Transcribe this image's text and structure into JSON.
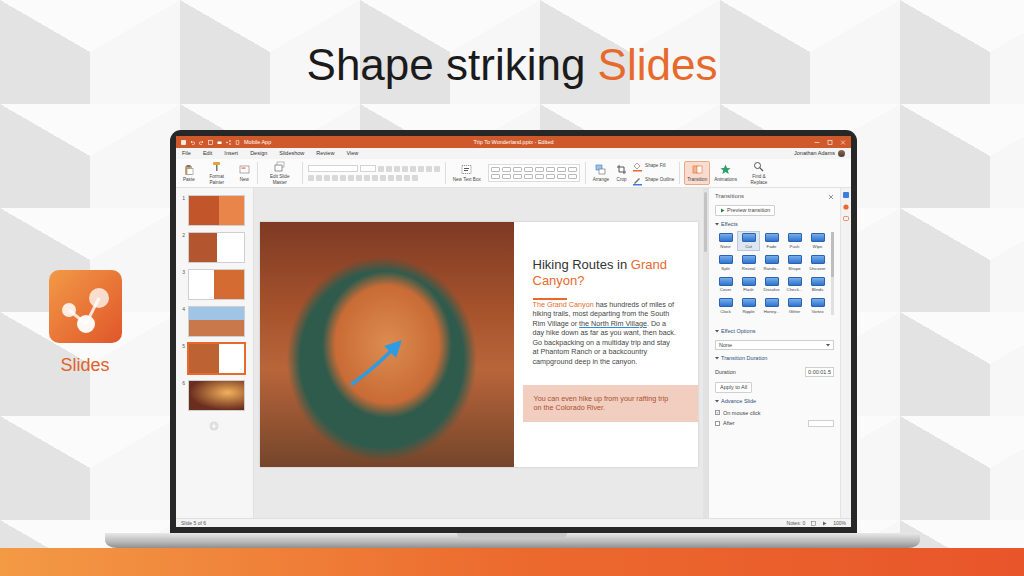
{
  "headline": [
    {
      "text": "Shape striking ",
      "kind": "plain"
    },
    {
      "text": "Slides",
      "kind": "accent"
    }
  ],
  "app_badge": {
    "label": "Slides"
  },
  "window": {
    "title": "Trip To Wonderland.pptx - Edited",
    "app_label": "Mobile App",
    "user": "Jonathan Adams"
  },
  "menu": [
    "File",
    "Edit",
    "Insert",
    "Design",
    "Slideshow",
    "Review",
    "View"
  ],
  "ribbon": [
    {
      "items": [
        {
          "label": "Paste",
          "kind": "large",
          "selected": false
        },
        {
          "label": "Format Painter",
          "kind": "large",
          "selected": false
        },
        {
          "label": "New",
          "kind": "large",
          "selected": false
        }
      ]
    },
    {
      "items": [
        {
          "label": "Edit Slide Master",
          "kind": "large",
          "selected": false
        }
      ]
    },
    {
      "items": [
        {
          "label": "New Text Box",
          "kind": "large",
          "selected": false
        }
      ]
    },
    {
      "items": [
        {
          "label": "Arrange",
          "kind": "large",
          "selected": false
        },
        {
          "label": "Crop",
          "kind": "large",
          "selected": false
        },
        {
          "label": "Shape Fill",
          "kind": "small",
          "selected": false
        },
        {
          "label": "Shape Outline",
          "kind": "small",
          "selected": false
        }
      ]
    },
    {
      "items": [
        {
          "label": "Transition",
          "kind": "large",
          "selected": true
        },
        {
          "label": "Animations",
          "kind": "large",
          "selected": false
        },
        {
          "label": "Find & Replace",
          "kind": "large",
          "selected": false
        }
      ]
    }
  ],
  "thumbnails": [
    {
      "number": "1",
      "selected": false
    },
    {
      "number": "2",
      "selected": false
    },
    {
      "number": "3",
      "selected": false
    },
    {
      "number": "4",
      "selected": false
    },
    {
      "number": "5",
      "selected": true
    },
    {
      "number": "6",
      "selected": false
    }
  ],
  "slide": {
    "title": [
      {
        "text": "Hiking Routes in ",
        "kind": "plain"
      },
      {
        "text": "Grand Canyon?",
        "kind": "accent"
      }
    ],
    "body": [
      {
        "text": "The Grand Canyon",
        "kind": "accent"
      },
      {
        "text": " has hundreds of miles of hiking trails, most departing from the South Rim Village or ",
        "kind": "plain"
      },
      {
        "text": "the North Rim Village",
        "kind": "underlined"
      },
      {
        "text": ". Do a day hike down as far as you want, then back. Go backpacking on a multiday trip and stay at Phantom Ranch or a backcountry campground deep in the canyon.",
        "kind": "plain"
      }
    ],
    "callout": "You can even hike up from your rafting trip on the Colorado River."
  },
  "transitions": {
    "title": "Transitions",
    "preview": "Preview transition",
    "effects_label": "Effects",
    "effects": [
      {
        "label": "None",
        "selected": false
      },
      {
        "label": "Cut",
        "selected": true
      },
      {
        "label": "Fade",
        "selected": false
      },
      {
        "label": "Push",
        "selected": false
      },
      {
        "label": "Wipe",
        "selected": false
      },
      {
        "label": "Split",
        "selected": false
      },
      {
        "label": "Reveal",
        "selected": false
      },
      {
        "label": "Rando...",
        "selected": false
      },
      {
        "label": "Shape",
        "selected": false
      },
      {
        "label": "Uncover",
        "selected": false
      },
      {
        "label": "Cover",
        "selected": false
      },
      {
        "label": "Flash",
        "selected": false
      },
      {
        "label": "Dissolve",
        "selected": false
      },
      {
        "label": "Check...",
        "selected": false
      },
      {
        "label": "Blinds",
        "selected": false
      },
      {
        "label": "Clock",
        "selected": false
      },
      {
        "label": "Ripple",
        "selected": false
      },
      {
        "label": "Honey...",
        "selected": false
      },
      {
        "label": "Glitter",
        "selected": false
      },
      {
        "label": "Vortex",
        "selected": false
      }
    ],
    "options_label": "Effect Options",
    "option_value": "None",
    "duration_label": "Transition Duration",
    "duration_field": "Duration",
    "duration_value": "0:00:01.5",
    "apply": "Apply to All",
    "advance_label": "Advance Slide",
    "advance": [
      {
        "label": "On mouse click",
        "checked": true
      },
      {
        "label": "After",
        "checked": false
      }
    ]
  },
  "status": {
    "slide": "Slide 5 of 6",
    "notes": "Notes: 0",
    "zoom": "100%"
  }
}
